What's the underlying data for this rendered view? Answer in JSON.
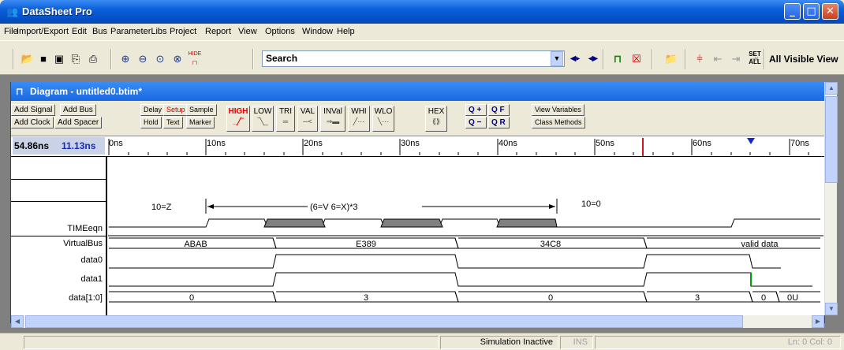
{
  "app": {
    "title": "DataSheet Pro",
    "window_controls": {
      "minimize": "_",
      "maximize": "□",
      "close": "✕"
    }
  },
  "menu": [
    "File",
    "Import/Export",
    "Edit",
    "Bus",
    "ParameterLibs",
    "Project",
    "Report",
    "View",
    "Options",
    "Window",
    "Help"
  ],
  "toolbar": {
    "search_label": "Search",
    "view_label": "All Visible View",
    "hide_label": "HIDE",
    "set_all_label": "SET ALL",
    "icons": [
      "open-icon",
      "save-icon",
      "save-all-icon",
      "ole-icon",
      "print-icon",
      "zoom-in-icon",
      "zoom-out-icon",
      "zoom-fit-icon",
      "zoom-range-icon",
      "hide-signals-icon",
      "search-prev-icon",
      "search-next-icon",
      "add-marker-icon",
      "clock-params-icon",
      "folder-icon",
      "timing-icon",
      "step-left-icon",
      "step-mid-icon",
      "step-right-icon"
    ]
  },
  "diagram": {
    "title": "Diagram - untitled0.btim*",
    "buttons": {
      "add_signal": "Add Signal",
      "add_bus": "Add Bus",
      "add_clock": "Add Clock",
      "add_spacer": "Add Spacer",
      "delay": "Delay",
      "setup": "Setup",
      "sample": "Sample",
      "hold": "Hold",
      "text": "Text",
      "marker": "Marker",
      "high": "HIGH",
      "low": "LOW",
      "tri": "TRI",
      "val": "VAL",
      "inval": "INVal",
      "whi": "WHI",
      "wlo": "WLO",
      "hex": "HEX",
      "zoom_plus": "Q +",
      "zoom_f": "Q F",
      "zoom_minus": "Q −",
      "zoom_r": "Q R",
      "view_variables": "View Variables",
      "class_methods": "Class Methods"
    },
    "cursor_time": "54.86ns",
    "delta_time": "11.13ns",
    "time_ticks": [
      "0ns",
      "10ns",
      "20ns",
      "30ns",
      "40ns",
      "50ns",
      "60ns",
      "70ns"
    ],
    "signals": [
      "TIMEeqn",
      "VirtualBus",
      "data0",
      "data1",
      "data[1:0]"
    ],
    "annotations": {
      "z": "10=Z",
      "formula": "(6=V 6=X)*3",
      "zero": "10=0"
    },
    "bus_values": [
      "ABAB",
      "E389",
      "34C8",
      "valid data"
    ],
    "data_values": [
      "0",
      "3",
      "0",
      "3",
      "0",
      "0U"
    ]
  },
  "status": {
    "simulation": "Simulation Inactive",
    "mode": "INS",
    "position": "Ln: 0  Col: 0"
  },
  "colors": {
    "title_blue": "#0550c8",
    "grid_red": "#d0141e",
    "marker_blue": "#1428c8",
    "pulse_gray": "#808080",
    "green_edge": "#00a000"
  }
}
